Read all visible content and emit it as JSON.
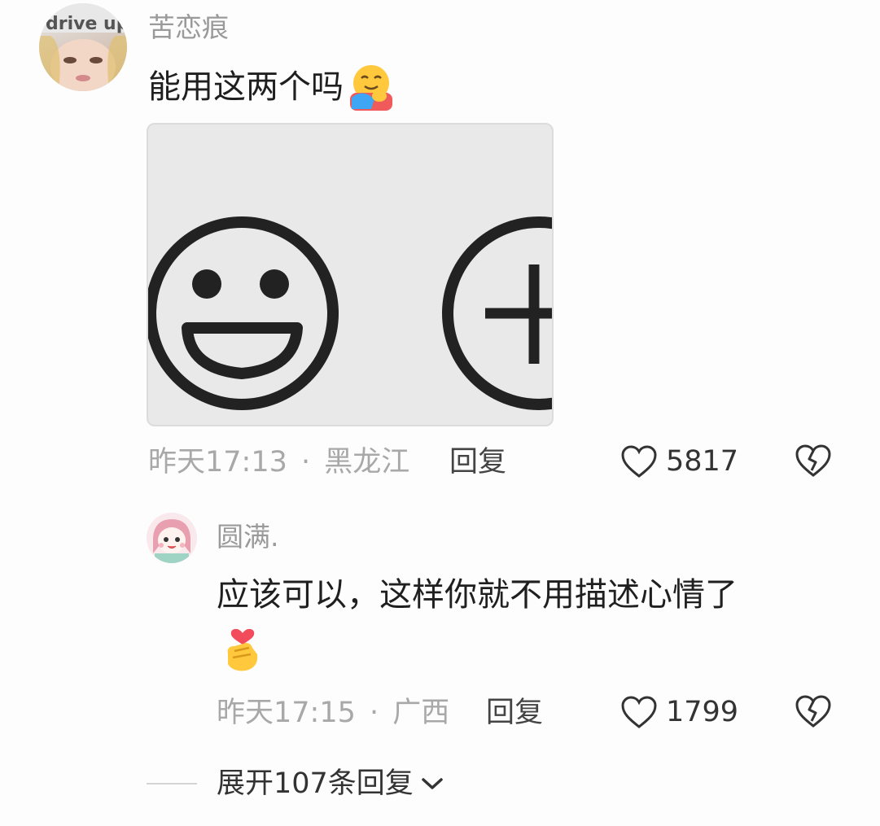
{
  "comment": {
    "username": "苦恋痕",
    "avatar_text": "drive up",
    "text": "能用这两个吗",
    "emoji": "hugging-face-emoji",
    "image_icons": [
      "smiley-face-icon",
      "add-circle-icon"
    ],
    "time": "昨天17:13",
    "separator": "·",
    "location": "黑龙江",
    "reply_label": "回复",
    "likes": "5817"
  },
  "reply": {
    "username": "圆满.",
    "text_line1": "应该可以，这样你就不用描述心情了",
    "emoji": "heart-hands-emoji",
    "time": "昨天17:15",
    "separator": "·",
    "location": "广西",
    "reply_label": "回复",
    "likes": "1799"
  },
  "expand": {
    "label": "展开107条回复"
  }
}
